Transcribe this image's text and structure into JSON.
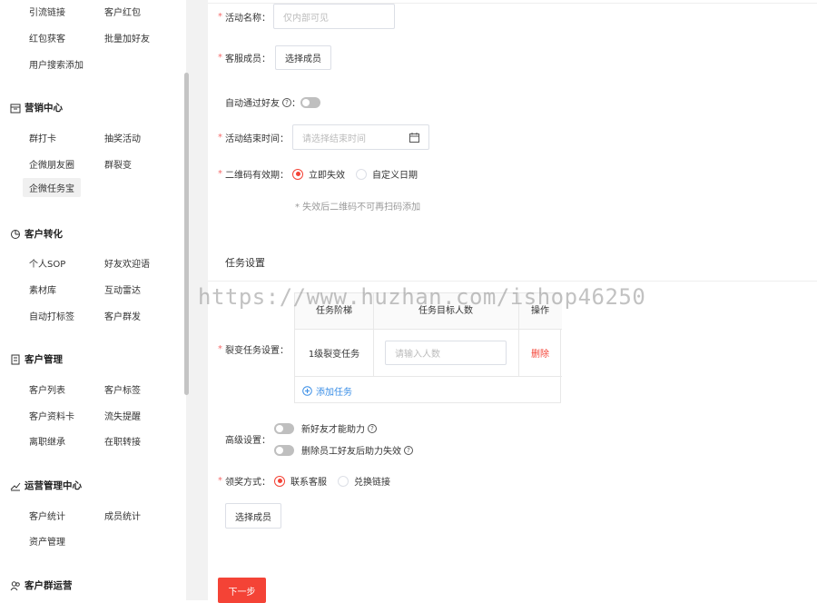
{
  "sidebar": {
    "top_items": [
      "引流链接",
      "客户红包",
      "红包获客",
      "批量加好友",
      "用户搜索添加"
    ],
    "sections": [
      {
        "title": "营销中心",
        "items": [
          "群打卡",
          "抽奖活动",
          "企微朋友圈",
          "群裂变",
          "企微任务宝"
        ]
      },
      {
        "title": "客户转化",
        "items": [
          "个人SOP",
          "好友欢迎语",
          "素材库",
          "互动雷达",
          "自动打标签",
          "客户群发"
        ]
      },
      {
        "title": "客户管理",
        "items": [
          "客户列表",
          "客户标签",
          "客户资料卡",
          "流失提醒",
          "离职继承",
          "在职转接"
        ]
      },
      {
        "title": "运营管理中心",
        "items": [
          "客户统计",
          "成员统计",
          "资产管理"
        ]
      },
      {
        "title": "客户群运营",
        "items": []
      }
    ]
  },
  "form": {
    "activity_name": {
      "label": "活动名称：",
      "placeholder": "仅内部可见"
    },
    "service_member": {
      "label": "客服成员：",
      "button": "选择成员"
    },
    "auto_accept": {
      "label": "自动通过好友",
      "colon": "："
    },
    "end_time": {
      "label": "活动结束时间：",
      "placeholder": "请选择结束时间"
    },
    "qrcode_validity": {
      "label": "二维码有效期：",
      "option1": "立即失效",
      "option2": "自定义日期",
      "hint": "* 失效后二维码不可再扫码添加"
    },
    "task_settings_title": "任务设置",
    "fission_task": {
      "label": "裂变任务设置：",
      "columns": [
        "任务阶梯",
        "任务目标人数",
        "操作"
      ],
      "rows": [
        {
          "stage": "1级裂变任务",
          "placeholder": "请输入人数",
          "action": "删除"
        }
      ],
      "add_label": "添加任务"
    },
    "advanced": {
      "label": "高级设置：",
      "option1": "新好友才能助力",
      "option2": "删除员工好友后助力失效"
    },
    "reward_method": {
      "label": "领奖方式：",
      "option1": "联系客服",
      "option2": "兑换链接",
      "button": "选择成员"
    },
    "next_button": "下一步"
  },
  "watermark": "https://www.huzhan.com/ishop46250",
  "colors": {
    "accent": "#f44336",
    "link": "#3a8ee6",
    "required": "#f56c6c"
  }
}
